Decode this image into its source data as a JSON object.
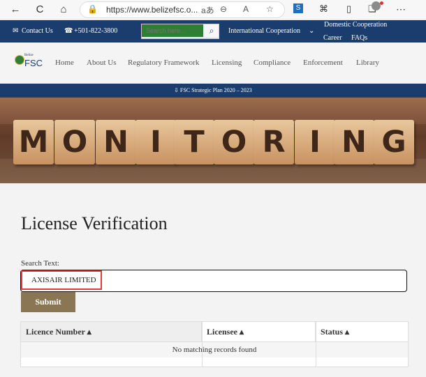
{
  "browser": {
    "back": "←",
    "reload": "C",
    "home": "⌂",
    "url": "https://www.belizefsc.o...",
    "read_aloud": "aあ",
    "zoom_out": "⊖",
    "text_size": "A",
    "favorite": "☆"
  },
  "topbar": {
    "contact": "Contact Us",
    "phone": "+501-822-3800",
    "search_placeholder": "Search here...",
    "international": "International Cooperation",
    "domestic": "Domestic Cooperation",
    "career": "Career",
    "faqs": "FAQs"
  },
  "logo": {
    "small": "Belize",
    "main": "FSC"
  },
  "nav": {
    "home": "Home",
    "about": "About Us",
    "regulatory": "Regulatory Framework",
    "licensing": "Licensing",
    "compliance": "Compliance",
    "enforcement": "Enforcement",
    "library": "Library"
  },
  "plan": "FSC Strategic Plan 2020 – 2023",
  "banner": {
    "letters": [
      "M",
      "O",
      "N",
      "I",
      "T",
      "O",
      "R",
      "I",
      "N",
      "G"
    ]
  },
  "page": {
    "title": "License Verification",
    "search_label": "Search Text:",
    "query": "AXISAIR LIMITED",
    "submit": "Submit"
  },
  "table": {
    "headers": [
      "Licence Number ▴",
      "Licensee ▴",
      "Status ▴"
    ],
    "empty": "No matching records found"
  }
}
